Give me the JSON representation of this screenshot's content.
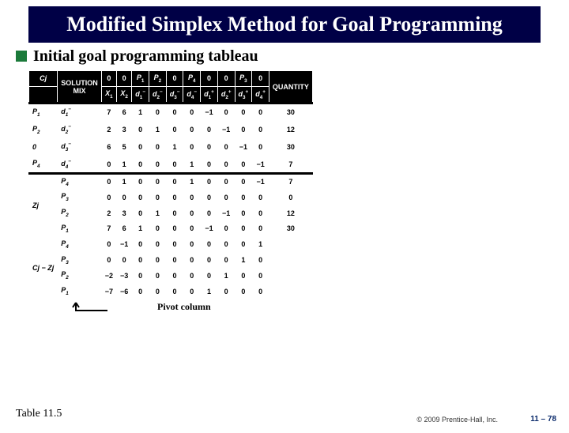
{
  "title": "Modified Simplex Method for Goal Programming",
  "subhead": "Initial goal programming tableau",
  "caption": "Table 11.5",
  "copyright": "© 2009 Prentice-Hall, Inc.",
  "slidenum": "11 – 78",
  "pivot_label": "Pivot column",
  "cj_label": "Cj",
  "solution_mix_label_1": "SOLUTION",
  "solution_mix_label_2": "MIX",
  "quantity_label": "QUANTITY",
  "top_row": [
    "0",
    "0",
    "P1",
    "P2",
    "0",
    "P4",
    "0",
    "0",
    "P3",
    "0"
  ],
  "col_headers": [
    "X1",
    "X2",
    "d1−",
    "d2−",
    "d3−",
    "d4−",
    "d1+",
    "d2+",
    "d3+",
    "d4+"
  ],
  "main_rows": [
    {
      "l": "P1",
      "m": "d1−",
      "v": [
        "7",
        "6",
        "1",
        "0",
        "0",
        "0",
        "−1",
        "0",
        "0",
        "0"
      ],
      "q": "30"
    },
    {
      "l": "P2",
      "m": "d2−",
      "v": [
        "2",
        "3",
        "0",
        "1",
        "0",
        "0",
        "0",
        "−1",
        "0",
        "0"
      ],
      "q": "12"
    },
    {
      "l": "0",
      "m": "d3−",
      "v": [
        "6",
        "5",
        "0",
        "0",
        "1",
        "0",
        "0",
        "0",
        "−1",
        "0"
      ],
      "q": "30"
    },
    {
      "l": "P4",
      "m": "d4−",
      "v": [
        "0",
        "1",
        "0",
        "0",
        "0",
        "1",
        "0",
        "0",
        "0",
        "−1"
      ],
      "q": "7"
    }
  ],
  "zj_label": "Zj",
  "zj_rows": [
    {
      "m": "P4",
      "v": [
        "0",
        "1",
        "0",
        "0",
        "0",
        "1",
        "0",
        "0",
        "0",
        "−1"
      ],
      "q": "7"
    },
    {
      "m": "P3",
      "v": [
        "0",
        "0",
        "0",
        "0",
        "0",
        "0",
        "0",
        "0",
        "0",
        "0"
      ],
      "q": "0"
    },
    {
      "m": "P2",
      "v": [
        "2",
        "3",
        "0",
        "1",
        "0",
        "0",
        "0",
        "−1",
        "0",
        "0"
      ],
      "q": "12"
    },
    {
      "m": "P1",
      "v": [
        "7",
        "6",
        "1",
        "0",
        "0",
        "0",
        "−1",
        "0",
        "0",
        "0"
      ],
      "q": "30"
    }
  ],
  "cz_label": "Cj − Zj",
  "cz_rows": [
    {
      "m": "P4",
      "v": [
        "0",
        "−1",
        "0",
        "0",
        "0",
        "0",
        "0",
        "0",
        "0",
        "1"
      ]
    },
    {
      "m": "P3",
      "v": [
        "0",
        "0",
        "0",
        "0",
        "0",
        "0",
        "0",
        "0",
        "1",
        "0"
      ]
    },
    {
      "m": "P2",
      "v": [
        "−2",
        "−3",
        "0",
        "0",
        "0",
        "0",
        "0",
        "1",
        "0",
        "0"
      ]
    },
    {
      "m": "P1",
      "v": [
        "−7",
        "−6",
        "0",
        "0",
        "0",
        "0",
        "1",
        "0",
        "0",
        "0"
      ]
    }
  ],
  "chart_data": {
    "type": "table",
    "title": "Initial goal programming tableau",
    "columns": [
      "priority",
      "solution_mix",
      "X1",
      "X2",
      "d1-",
      "d2-",
      "d3-",
      "d4-",
      "d1+",
      "d2+",
      "d3+",
      "d4+",
      "quantity"
    ],
    "cj_priorities": [
      "0",
      "0",
      "P1",
      "P2",
      "0",
      "P4",
      "0",
      "0",
      "P3",
      "0"
    ],
    "basis": [
      {
        "priority": "P1",
        "var": "d1-",
        "row": [
          7,
          6,
          1,
          0,
          0,
          0,
          -1,
          0,
          0,
          0
        ],
        "q": 30
      },
      {
        "priority": "P2",
        "var": "d2-",
        "row": [
          2,
          3,
          0,
          1,
          0,
          0,
          0,
          -1,
          0,
          0
        ],
        "q": 12
      },
      {
        "priority": "0",
        "var": "d3-",
        "row": [
          6,
          5,
          0,
          0,
          1,
          0,
          0,
          0,
          -1,
          0
        ],
        "q": 30
      },
      {
        "priority": "P4",
        "var": "d4-",
        "row": [
          0,
          1,
          0,
          0,
          0,
          1,
          0,
          0,
          0,
          -1
        ],
        "q": 7
      }
    ],
    "Zj": {
      "P4": [
        0,
        1,
        0,
        0,
        0,
        1,
        0,
        0,
        0,
        -1,
        7
      ],
      "P3": [
        0,
        0,
        0,
        0,
        0,
        0,
        0,
        0,
        0,
        0,
        0
      ],
      "P2": [
        2,
        3,
        0,
        1,
        0,
        0,
        0,
        -1,
        0,
        0,
        12
      ],
      "P1": [
        7,
        6,
        1,
        0,
        0,
        0,
        -1,
        0,
        0,
        0,
        30
      ]
    },
    "Cj_minus_Zj": {
      "P4": [
        0,
        -1,
        0,
        0,
        0,
        0,
        0,
        0,
        0,
        1
      ],
      "P3": [
        0,
        0,
        0,
        0,
        0,
        0,
        0,
        0,
        1,
        0
      ],
      "P2": [
        -2,
        -3,
        0,
        0,
        0,
        0,
        0,
        1,
        0,
        0
      ],
      "P1": [
        -7,
        -6,
        0,
        0,
        0,
        0,
        1,
        0,
        0,
        0
      ]
    },
    "pivot_column": "X1"
  }
}
